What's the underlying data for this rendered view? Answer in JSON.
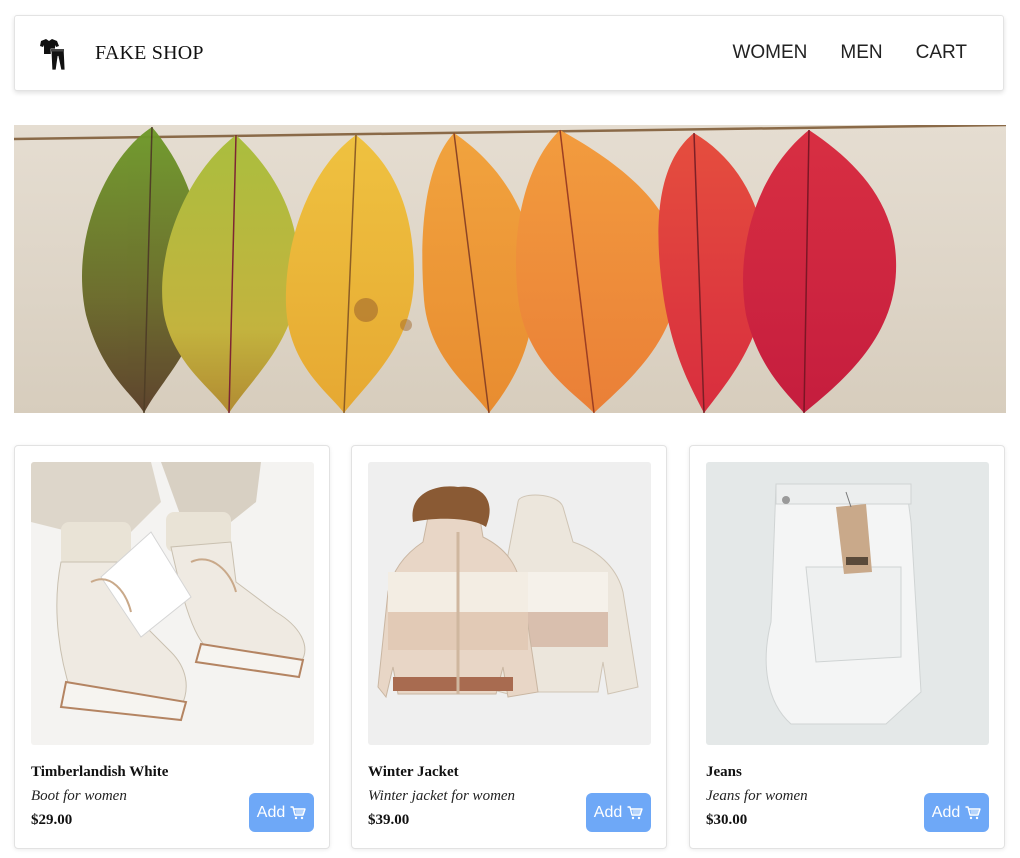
{
  "header": {
    "brand": "FAKE SHOP",
    "logo_icon": "clothing-icon",
    "nav": [
      {
        "label": "WOMEN"
      },
      {
        "label": "MEN"
      },
      {
        "label": "CART"
      }
    ]
  },
  "hero": {
    "image": "autumn-leaves-on-string"
  },
  "products": [
    {
      "name": "Timberlandish White",
      "description": "Boot for women",
      "price": "$29.00",
      "add_label": "Add",
      "image": "white-boots"
    },
    {
      "name": "Winter Jacket",
      "description": "Winter jacket for women",
      "price": "$39.00",
      "add_label": "Add",
      "image": "puffer-jackets"
    },
    {
      "name": "Jeans",
      "description": "Jeans for women",
      "price": "$30.00",
      "add_label": "Add",
      "image": "white-jeans"
    }
  ],
  "colors": {
    "accent": "#6ea8f7",
    "text": "#111111"
  }
}
